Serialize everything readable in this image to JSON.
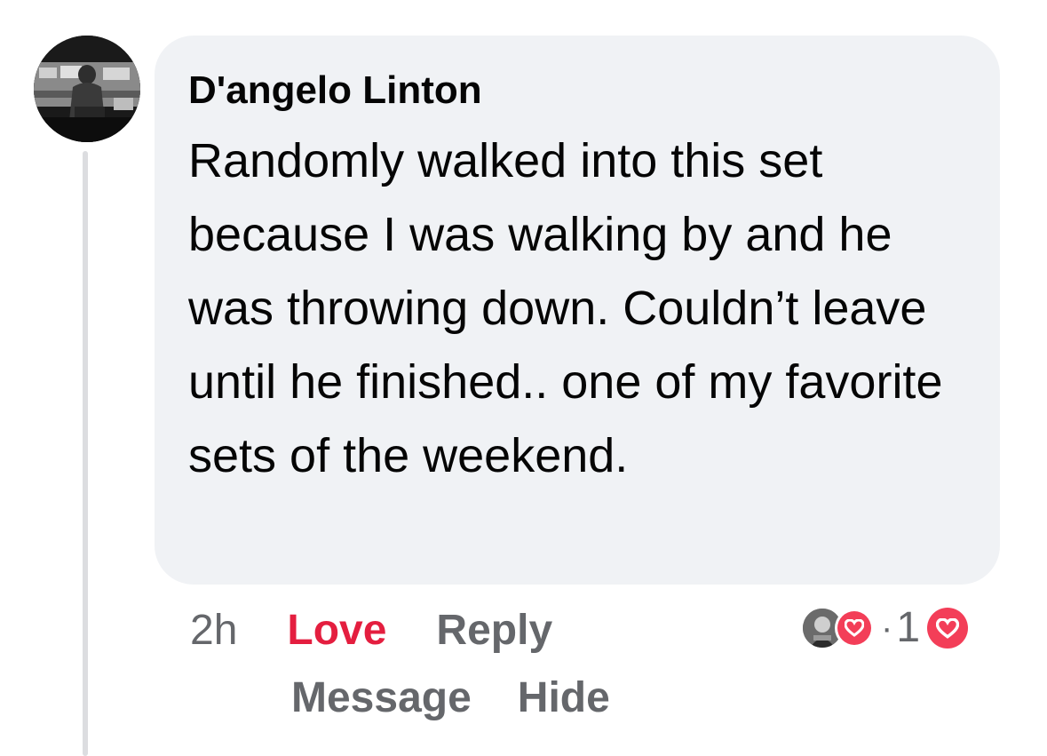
{
  "comment": {
    "author": "D'angelo Linton",
    "text": "Randomly walked into this set because I was walking by and he was throwing down. Couldn’t leave until he finished.. one of my favorite sets of the weekend.",
    "timestamp": "2h"
  },
  "actions": {
    "love_label": "Love",
    "reply_label": "Reply",
    "message_label": "Message",
    "hide_label": "Hide"
  },
  "reactions": {
    "separator": "·",
    "count": "1",
    "reaction_icon": "heart-icon"
  },
  "colors": {
    "love_accent": "#e41e3f",
    "heart_badge": "#f33e58",
    "bubble_bg": "#f0f2f5",
    "secondary_text": "#65676b"
  }
}
